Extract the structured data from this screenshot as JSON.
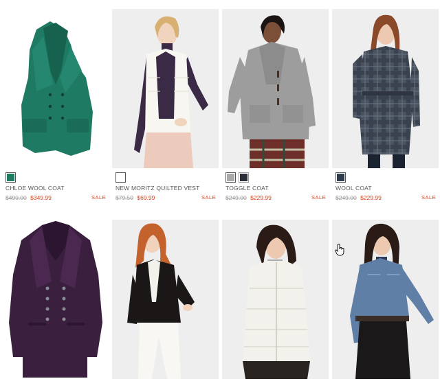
{
  "products": [
    {
      "name": "CHLOE WOOL COAT",
      "price_original": "$490.00",
      "price_sale": "$349.99",
      "sale_label": "SALE",
      "swatch_colors": [
        "#1f7a64"
      ],
      "main_color": "#1f7a64"
    },
    {
      "name": "NEW MORITZ QUILTED VEST",
      "price_original": "$79.50",
      "price_sale": "$69.99",
      "sale_label": "SALE",
      "swatch_colors": [
        "#ffffff"
      ],
      "main_color": "#f4f1ea"
    },
    {
      "name": "TOGGLE COAT",
      "price_original": "$249.00",
      "price_sale": "$229.99",
      "sale_label": "SALE",
      "swatch_colors": [
        "#a9a9a9",
        "#2a2d35"
      ],
      "main_color": "#9b9b9b"
    },
    {
      "name": "WOOL COAT",
      "price_original": "$249.00",
      "price_sale": "$229.99",
      "sale_label": "SALE",
      "swatch_colors": [
        "#2f3a4a"
      ],
      "main_color": "#4a5360"
    },
    {
      "main_color": "#3b1f3f"
    },
    {
      "main_color": "#1b1717"
    },
    {
      "main_color": "#f3f1ec"
    },
    {
      "main_color": "#5f7fa6"
    }
  ],
  "colors": {
    "sale": "#d8431d",
    "old_price": "#9a9a9a",
    "text": "#555555"
  },
  "cursor": "hand-pointer-icon"
}
